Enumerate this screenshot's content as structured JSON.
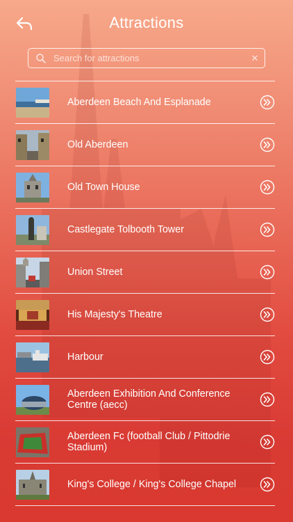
{
  "header": {
    "title": "Attractions",
    "back_icon": "back-arrow-icon"
  },
  "search": {
    "placeholder": "Search for attractions",
    "value": "",
    "clear_label": "✕"
  },
  "attractions": [
    {
      "label": "Aberdeen Beach And Esplanade",
      "thumb": "beach"
    },
    {
      "label": "Old Aberdeen",
      "thumb": "street"
    },
    {
      "label": "Old Town House",
      "thumb": "townhouse"
    },
    {
      "label": "Castlegate Tolbooth Tower",
      "thumb": "statue"
    },
    {
      "label": "Union Street",
      "thumb": "union"
    },
    {
      "label": "His Majesty's Theatre",
      "thumb": "theatre"
    },
    {
      "label": "Harbour",
      "thumb": "harbour"
    },
    {
      "label": "Aberdeen Exhibition And Conference Centre (aecc)",
      "thumb": "aecc"
    },
    {
      "label": "Aberdeen Fc (football Club / Pittodrie Stadium)",
      "thumb": "stadium"
    },
    {
      "label": "King's College / King's College Chapel",
      "thumb": "college"
    }
  ],
  "colors": {
    "accent": "#ffffff",
    "bg_top": "#f7a98a",
    "bg_bottom": "#d9392f"
  }
}
